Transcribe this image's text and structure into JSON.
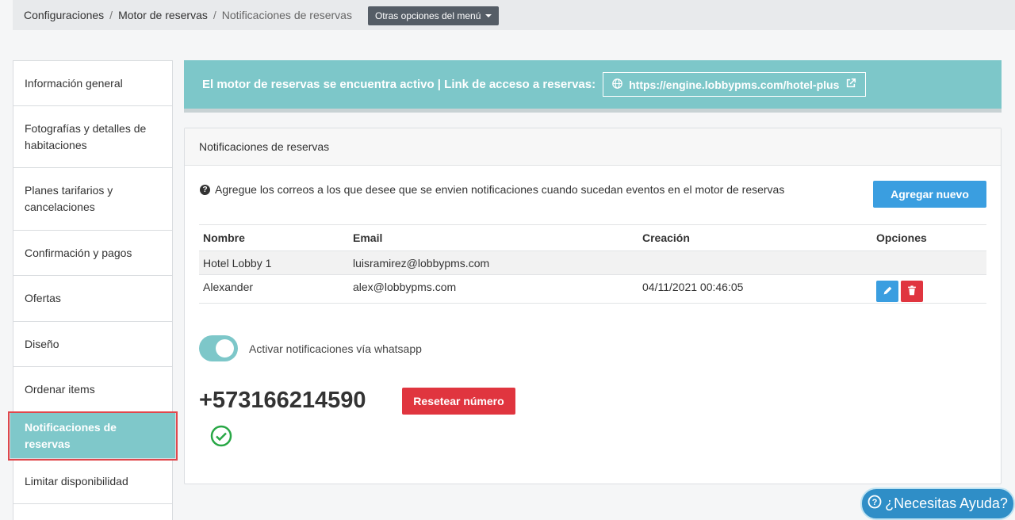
{
  "breadcrumb": {
    "items": [
      "Configuraciones",
      "Motor de reservas",
      "Notificaciones de reservas"
    ],
    "separator": "/",
    "menu_button": "Otras opciones del menú"
  },
  "sidebar": {
    "items": [
      {
        "label": "Información general"
      },
      {
        "label": "Fotografías y detalles de habitaciones"
      },
      {
        "label": "Planes tarifarios y cancelaciones"
      },
      {
        "label": "Confirmación y pagos"
      },
      {
        "label": "Ofertas"
      },
      {
        "label": "Diseño"
      },
      {
        "label": "Ordenar items"
      },
      {
        "label": "Notificaciones de reservas",
        "active": true
      },
      {
        "label": "Limitar disponibilidad"
      }
    ]
  },
  "banner": {
    "text": "El motor de reservas se encuentra activo | Link de acceso a reservas:",
    "link": "https://engine.lobbypms.com/hotel-plus"
  },
  "panel": {
    "title": "Notificaciones de reservas",
    "info": "Agregue los correos a los que desee que se envien notificaciones cuando sucedan eventos en el motor de reservas",
    "add_button": "Agregar nuevo",
    "table": {
      "headers": [
        "Nombre",
        "Email",
        "Creación",
        "Opciones"
      ],
      "rows": [
        {
          "nombre": "Hotel Lobby 1",
          "email": "luisramirez@lobbypms.com",
          "creacion": ""
        },
        {
          "nombre": "Alexander",
          "email": "alex@lobbypms.com",
          "creacion": "04/11/2021 00:46:05"
        }
      ]
    },
    "whatsapp_toggle_label": "Activar notificaciones vía whatsapp",
    "whatsapp_enabled": true,
    "phone": "+573166214590",
    "reset_button": "Resetear número"
  },
  "help_button": "¿Necesitas Ayuda?",
  "colors": {
    "teal": "#7dc7c9",
    "blue": "#3a9ee0",
    "red": "#e0353f",
    "green_check": "#28a745"
  }
}
